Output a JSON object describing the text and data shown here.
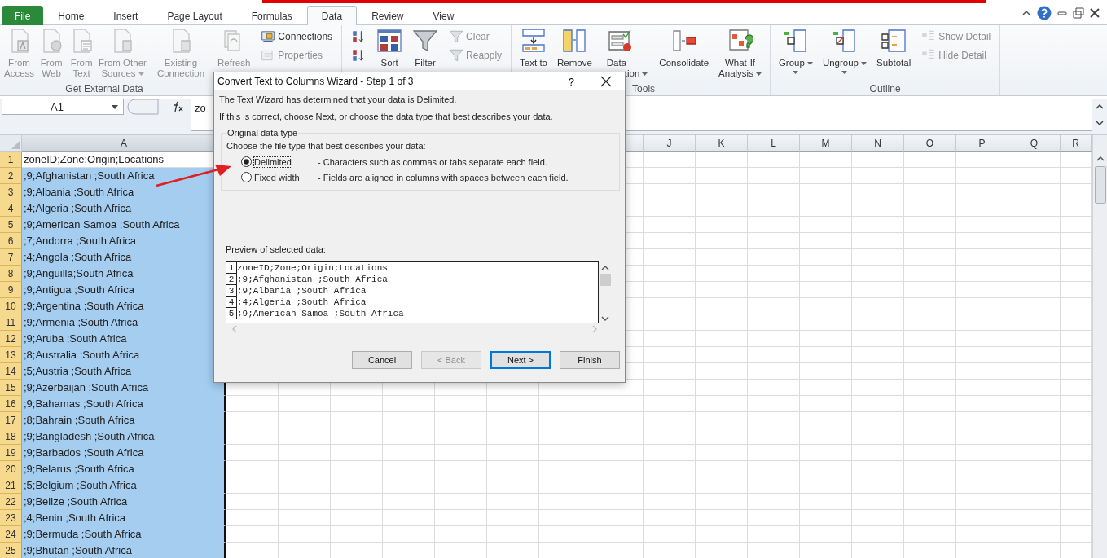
{
  "tabs": [
    {
      "label": "File",
      "kind": "file",
      "selected": false
    },
    {
      "label": "Home",
      "kind": "tab",
      "selected": false
    },
    {
      "label": "Insert",
      "kind": "tab",
      "selected": false
    },
    {
      "label": "Page Layout",
      "kind": "tab",
      "selected": false
    },
    {
      "label": "Formulas",
      "kind": "tab",
      "selected": false
    },
    {
      "label": "Data",
      "kind": "tab",
      "selected": true
    },
    {
      "label": "Review",
      "kind": "tab",
      "selected": false
    },
    {
      "label": "View",
      "kind": "tab",
      "selected": false
    }
  ],
  "ribbon": {
    "groups": [
      {
        "label": "Get External Data",
        "items": [
          {
            "kind": "large",
            "lines": [
              "From",
              "Access"
            ],
            "disabled": true,
            "dropdown": false
          },
          {
            "kind": "large",
            "lines": [
              "From",
              "Web"
            ],
            "disabled": true,
            "dropdown": false
          },
          {
            "kind": "large",
            "lines": [
              "From",
              "Text"
            ],
            "disabled": true,
            "dropdown": false
          },
          {
            "kind": "large",
            "lines": [
              "From Other",
              "Sources"
            ],
            "disabled": true,
            "dropdown": true
          },
          {
            "kind": "divider"
          },
          {
            "kind": "large",
            "lines": [
              "Existing",
              "Connection"
            ],
            "disabled": true,
            "dropdown": false
          }
        ]
      },
      {
        "items": [
          {
            "kind": "large",
            "lines": [
              "Refresh"
            ],
            "disabled": true,
            "dropdown": false
          },
          {
            "kind": "stack",
            "items": [
              {
                "label": "Connections",
                "disabled": false
              },
              {
                "label": "Properties",
                "disabled": true
              }
            ]
          }
        ]
      },
      {
        "items": [
          {
            "kind": "stack",
            "items": [
              {
                "disabled": false
              },
              {
                "disabled": false
              }
            ]
          },
          {
            "kind": "large",
            "lines": [
              "Sort"
            ],
            "disabled": false,
            "dropdown": false
          },
          {
            "kind": "large",
            "lines": [
              "Filter"
            ],
            "disabled": false,
            "dropdown": false
          },
          {
            "kind": "stack",
            "items": [
              {
                "label": "Clear",
                "disabled": true
              },
              {
                "label": "Reapply",
                "disabled": true
              }
            ]
          }
        ]
      },
      {
        "label": "Tools",
        "items": [
          {
            "kind": "large",
            "lines": [
              "Text to"
            ],
            "disabled": false,
            "dropdown": false
          },
          {
            "kind": "large",
            "lines": [
              "Remove"
            ],
            "disabled": false,
            "dropdown": false
          },
          {
            "kind": "large",
            "lines": [
              "Data",
              "tion"
            ],
            "disabled": false,
            "dropdown": true
          },
          {
            "kind": "large",
            "lines": [
              "Consolidate"
            ],
            "disabled": false,
            "dropdown": false
          },
          {
            "kind": "large",
            "lines": [
              "What-If",
              "Analysis"
            ],
            "disabled": false,
            "dropdown": true
          }
        ]
      },
      {
        "label": "Outline",
        "items": [
          {
            "kind": "large",
            "lines": [
              "Group"
            ],
            "disabled": false,
            "dropdown": true
          },
          {
            "kind": "large",
            "lines": [
              "Ungroup"
            ],
            "disabled": false,
            "dropdown": true
          },
          {
            "kind": "large",
            "lines": [
              "Subtotal"
            ],
            "disabled": false,
            "dropdown": false
          },
          {
            "kind": "stack",
            "items": [
              {
                "label": "Show Detail",
                "disabled": true
              },
              {
                "label": "Hide Detail",
                "disabled": true
              }
            ]
          }
        ]
      }
    ]
  },
  "formula_bar": {
    "name_box": "A1",
    "content": "zo"
  },
  "sheet": {
    "columns": [
      "A",
      "J",
      "K",
      "L",
      "M",
      "N",
      "O",
      "P",
      "Q",
      "R"
    ],
    "rows": [
      {
        "number": "1",
        "value": "zoneID;Zone;Origin;Locations",
        "active": true
      },
      {
        "number": "2",
        "value": ";9;Afghanistan ;South Africa",
        "active": false
      },
      {
        "number": "3",
        "value": ";9;Albania ;South Africa",
        "active": false
      },
      {
        "number": "4",
        "value": ";4;Algeria ;South Africa",
        "active": false
      },
      {
        "number": "5",
        "value": ";9;American Samoa ;South Africa",
        "active": false
      },
      {
        "number": "6",
        "value": ";7;Andorra ;South Africa",
        "active": false
      },
      {
        "number": "7",
        "value": ";4;Angola ;South Africa",
        "active": false
      },
      {
        "number": "8",
        "value": ";9;Anguilla;South Africa",
        "active": false
      },
      {
        "number": "9",
        "value": ";9;Antigua ;South Africa",
        "active": false
      },
      {
        "number": "10",
        "value": ";9;Argentina ;South Africa",
        "active": false
      },
      {
        "number": "11",
        "value": ";9;Armenia ;South Africa",
        "active": false
      },
      {
        "number": "12",
        "value": ";9;Aruba ;South Africa",
        "active": false
      },
      {
        "number": "13",
        "value": ";8;Australia ;South Africa",
        "active": false
      },
      {
        "number": "14",
        "value": ";5;Austria ;South Africa",
        "active": false
      },
      {
        "number": "15",
        "value": ";9;Azerbaijan ;South Africa",
        "active": false
      },
      {
        "number": "16",
        "value": ";9;Bahamas ;South Africa",
        "active": false
      },
      {
        "number": "17",
        "value": ";8;Bahrain ;South Africa",
        "active": false
      },
      {
        "number": "18",
        "value": ";9;Bangladesh ;South Africa",
        "active": false
      },
      {
        "number": "19",
        "value": ";9;Barbados ;South Africa",
        "active": false
      },
      {
        "number": "20",
        "value": ";9;Belarus ;South Africa",
        "active": false
      },
      {
        "number": "21",
        "value": ";5;Belgium ;South Africa",
        "active": false
      },
      {
        "number": "22",
        "value": ";9;Belize ;South Africa",
        "active": false
      },
      {
        "number": "23",
        "value": ";4;Benin ;South Africa",
        "active": false
      },
      {
        "number": "24",
        "value": ";9;Bermuda ;South Africa",
        "active": false
      },
      {
        "number": "25",
        "value": ";9;Bhutan ;South Africa",
        "active": false
      }
    ]
  },
  "dialog": {
    "title": "Convert Text to Columns Wizard - Step 1 of 3",
    "help": "?",
    "intro": [
      "The Text Wizard has determined that your data is Delimited.",
      "If this is correct, choose Next, or choose the data type that best describes your data."
    ],
    "group_title": "Original data type",
    "prompt": "Choose the file type that best describes your data:",
    "options": [
      {
        "label": "Delimited",
        "description": "- Characters such as commas or tabs separate each field.",
        "selected": true
      },
      {
        "label": "Fixed width",
        "description": "- Fields are aligned in columns with spaces between each field.",
        "selected": false
      }
    ],
    "preview_label": "Preview of selected data:",
    "preview": [
      {
        "number": "1",
        "text": "zoneID;Zone;Origin;Locations"
      },
      {
        "number": "2",
        "text": ";9;Afghanistan ;South Africa"
      },
      {
        "number": "3",
        "text": ";9;Albania ;South Africa"
      },
      {
        "number": "4",
        "text": ";4;Algeria ;South Africa"
      },
      {
        "number": "5",
        "text": ";9;American Samoa ;South Africa"
      }
    ],
    "buttons": [
      {
        "label": "Cancel",
        "disabled": false,
        "default": false
      },
      {
        "label": "< Back",
        "disabled": true,
        "default": false
      },
      {
        "label": "Next >",
        "disabled": false,
        "default": true
      },
      {
        "label": "Finish",
        "disabled": false,
        "default": false
      }
    ]
  }
}
